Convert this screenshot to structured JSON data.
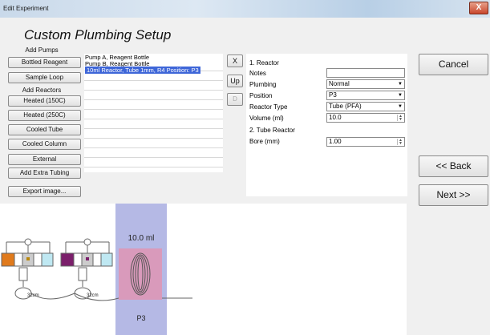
{
  "window": {
    "title": "Edit Experiment",
    "close_label": "X"
  },
  "heading": "Custom Plumbing Setup",
  "add_pumps": {
    "label": "Add Pumps",
    "buttons": [
      "Bottled Reagent",
      "Sample Loop"
    ]
  },
  "add_reactors": {
    "label": "Add Reactors",
    "buttons": [
      "Heated (150C)",
      "Heated (250C)",
      "Cooled Tube",
      "Cooled Column",
      "External",
      "Add Extra Tubing"
    ]
  },
  "export_label": "Export image...",
  "component_list": {
    "items": [
      "Pump A, Reagent Bottle",
      "Pump B, Reagent Bottle",
      "10ml Reactor, Tube 1mm, R4 Position: P3"
    ],
    "selected_index": 2
  },
  "list_controls": {
    "remove": "X",
    "up": "Up",
    "down": "D"
  },
  "properties": {
    "section1": "1. Reactor",
    "notes_label": "Notes",
    "notes_value": "",
    "plumbing_label": "Plumbing",
    "plumbing_value": "Normal",
    "position_label": "Position",
    "position_value": "P3",
    "reactor_type_label": "Reactor Type",
    "reactor_type_value": "Tube (PFA)",
    "volume_label": "Volume (ml)",
    "volume_value": "10.0",
    "section2": "2. Tube Reactor",
    "bore_label": "Bore (mm)",
    "bore_value": "1.00"
  },
  "actions": {
    "cancel": "Cancel",
    "back": "<< Back",
    "next": "Next >>"
  },
  "diagram": {
    "reactor_volume": "10.0 ml",
    "position": "P3",
    "loop_labels": [
      "32cm",
      "32cm"
    ],
    "colors": {
      "pump_a": "#e07a1c",
      "pump_b": "#7b1f6b",
      "reagent": "#bfe8f2",
      "reactor_panel": "#b5b9e5",
      "reactor_heat": "#d99abb"
    }
  }
}
